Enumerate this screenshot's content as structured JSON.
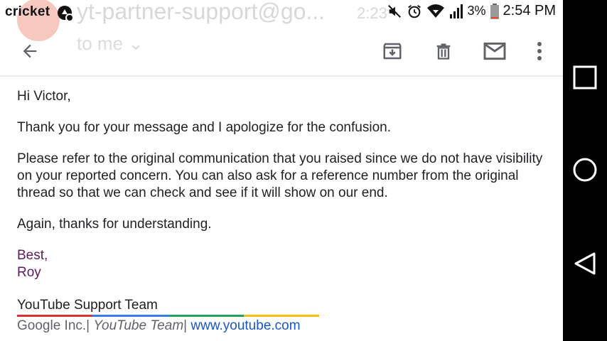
{
  "status_bar": {
    "carrier": "cricket",
    "battery": "3%",
    "time": "2:54 PM"
  },
  "header": {
    "sender_email": "yt-partner-support@go...",
    "received_time": "2:23",
    "recipient": "to me"
  },
  "toolbar": {
    "back": "arrow-left-icon",
    "archive": "archive-icon",
    "delete": "trash-icon",
    "mark_unread": "mail-icon",
    "more": "more-vert-icon"
  },
  "message": {
    "greeting": "Hi Victor,",
    "paragraph_1": "Thank you for your message and I apologize for the confusion.",
    "paragraph_2": "Please refer to the original communication that you raised since we do not have visibility on your reported concern. You can also ask for a reference number from the original thread so that we can check and see if it will show on our end.",
    "paragraph_3": "Again, thanks for understanding.",
    "sign_off": "Best,",
    "sender_name": "Roy",
    "team": "YouTube Support Team",
    "footer_company": "Google Inc.|",
    "footer_team": "YouTube Team",
    "footer_sep": "|",
    "footer_link": "www.youtube.com"
  },
  "colors": {
    "signature": "#5c1a5c",
    "link": "#1a55c8",
    "rainbow": [
      "#db3236",
      "#3c7bed",
      "#21a25b",
      "#f4c20d"
    ]
  },
  "nav": {
    "recents": "square-icon",
    "home": "circle-icon",
    "back": "triangle-back-icon"
  }
}
